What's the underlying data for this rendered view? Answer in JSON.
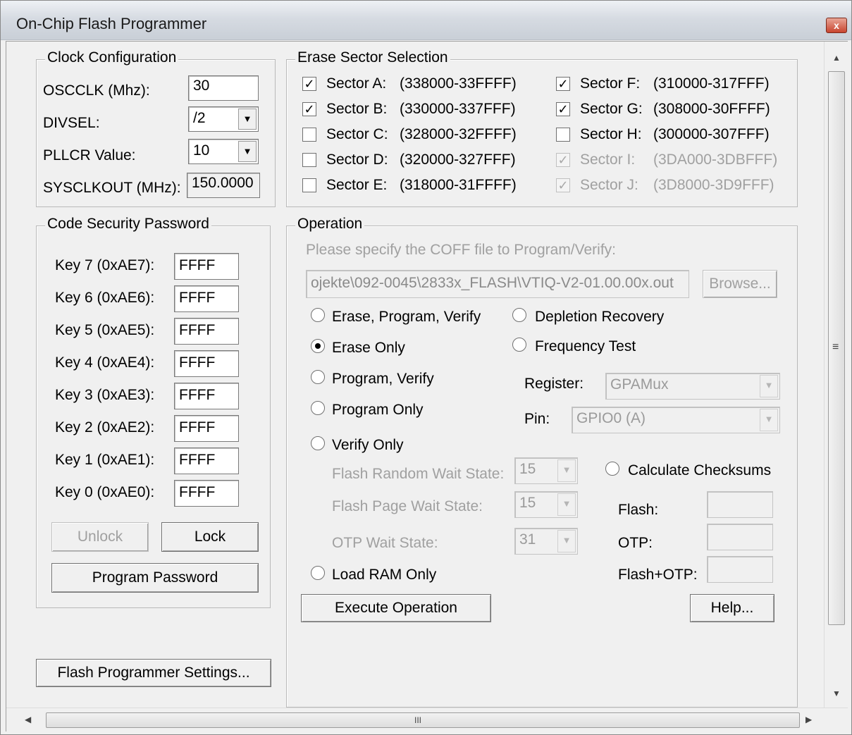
{
  "window": {
    "title": "On-Chip Flash Programmer",
    "close_glyph": "x"
  },
  "clock": {
    "legend": "Clock Configuration",
    "oscclk_label": "OSCCLK (Mhz):",
    "oscclk_value": "30",
    "divsel_label": "DIVSEL:",
    "divsel_value": "/2",
    "pllcr_label": "PLLCR Value:",
    "pllcr_value": "10",
    "sysclk_label": "SYSCLKOUT (MHz):",
    "sysclk_value": "150.0000"
  },
  "erase": {
    "legend": "Erase Sector Selection",
    "sectors": [
      {
        "name": "Sector A:",
        "range": "(338000-33FFFF)",
        "checked": true,
        "enabled": true
      },
      {
        "name": "Sector B:",
        "range": "(330000-337FFF)",
        "checked": true,
        "enabled": true
      },
      {
        "name": "Sector C:",
        "range": "(328000-32FFFF)",
        "checked": false,
        "enabled": true
      },
      {
        "name": "Sector D:",
        "range": "(320000-327FFF)",
        "checked": false,
        "enabled": true
      },
      {
        "name": "Sector E:",
        "range": "(318000-31FFFF)",
        "checked": false,
        "enabled": true
      },
      {
        "name": "Sector F:",
        "range": "(310000-317FFF)",
        "checked": true,
        "enabled": true
      },
      {
        "name": "Sector G:",
        "range": "(308000-30FFFF)",
        "checked": true,
        "enabled": true
      },
      {
        "name": "Sector H:",
        "range": "(300000-307FFF)",
        "checked": false,
        "enabled": true
      },
      {
        "name": "Sector I:",
        "range": "(3DA000-3DBFFF)",
        "checked": true,
        "enabled": false
      },
      {
        "name": "Sector J:",
        "range": "(3D8000-3D9FFF)",
        "checked": true,
        "enabled": false
      }
    ]
  },
  "security": {
    "legend": "Code Security Password",
    "keys": [
      {
        "label": "Key 7 (0xAE7):",
        "value": "FFFF"
      },
      {
        "label": "Key 6 (0xAE6):",
        "value": "FFFF"
      },
      {
        "label": "Key 5 (0xAE5):",
        "value": "FFFF"
      },
      {
        "label": "Key 4 (0xAE4):",
        "value": "FFFF"
      },
      {
        "label": "Key 3 (0xAE3):",
        "value": "FFFF"
      },
      {
        "label": "Key 2 (0xAE2):",
        "value": "FFFF"
      },
      {
        "label": "Key 1 (0xAE1):",
        "value": "FFFF"
      },
      {
        "label": "Key 0 (0xAE0):",
        "value": "FFFF"
      }
    ],
    "unlock_label": "Unlock",
    "lock_label": "Lock",
    "program_password_label": "Program Password"
  },
  "settings_button_label": "Flash Programmer Settings...",
  "operation": {
    "legend": "Operation",
    "coff_prompt": "Please specify the COFF file to Program/Verify:",
    "coff_path": "ojekte\\092-0045\\2833x_FLASH\\VTIQ-V2-01.00.00x.out",
    "browse_label": "Browse...",
    "options": {
      "erase_program_verify": "Erase, Program, Verify",
      "erase_only": "Erase Only",
      "program_verify": "Program, Verify",
      "program_only": "Program Only",
      "verify_only": "Verify Only",
      "load_ram_only": "Load RAM Only",
      "depletion_recovery": "Depletion Recovery",
      "frequency_test": "Frequency Test",
      "calculate_checksums": "Calculate Checksums"
    },
    "selected_option": "erase_only",
    "register_label": "Register:",
    "register_value": "GPAMux",
    "pin_label": "Pin:",
    "pin_value": "GPIO0 (A)",
    "flash_random_wait_label": "Flash Random Wait State:",
    "flash_random_wait_value": "15",
    "flash_page_wait_label": "Flash Page Wait State:",
    "flash_page_wait_value": "15",
    "otp_wait_label": "OTP Wait State:",
    "otp_wait_value": "31",
    "checksum_flash_label": "Flash:",
    "checksum_otp_label": "OTP:",
    "checksum_flash_otp_label": "Flash+OTP:",
    "execute_label": "Execute Operation",
    "help_label": "Help..."
  },
  "scrollbars": {
    "up": "▲",
    "down": "▼",
    "left": "◀",
    "right": "▶",
    "grip_v": "≡",
    "grip_h": "III"
  }
}
